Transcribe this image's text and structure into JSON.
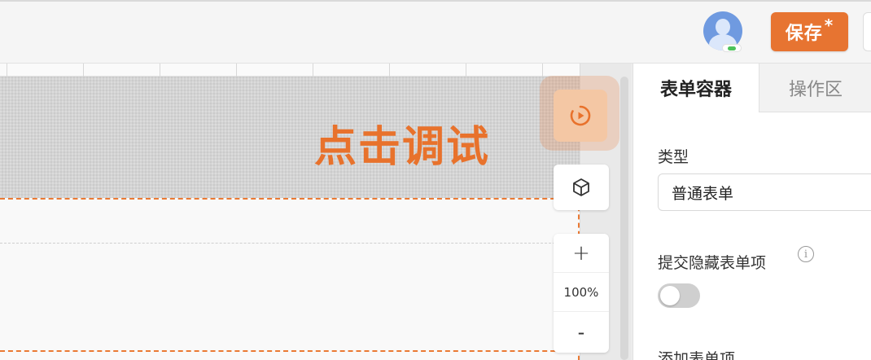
{
  "header": {
    "save_label": "保存",
    "save_modified_marker": "*",
    "avatar_icon": "user-avatar-icon",
    "online_status": "online"
  },
  "canvas": {
    "debug_hint_text": "点击调试",
    "accent_color": "#e8722c"
  },
  "toolbar": {
    "debug_icon": "play-circle-icon",
    "component_icon": "cube-icon",
    "zoom_in_label": "+",
    "zoom_value": "100%",
    "zoom_out_label": "-"
  },
  "panel": {
    "tabs": [
      {
        "label": "表单容器",
        "active": true
      },
      {
        "label": "操作区",
        "active": false
      }
    ],
    "type_label": "类型",
    "type_value": "普通表单",
    "submit_hidden_label": "提交隐藏表单项",
    "submit_hidden_info_icon": "info-icon",
    "submit_hidden_enabled": false,
    "add_items_label": "添加表单项"
  }
}
